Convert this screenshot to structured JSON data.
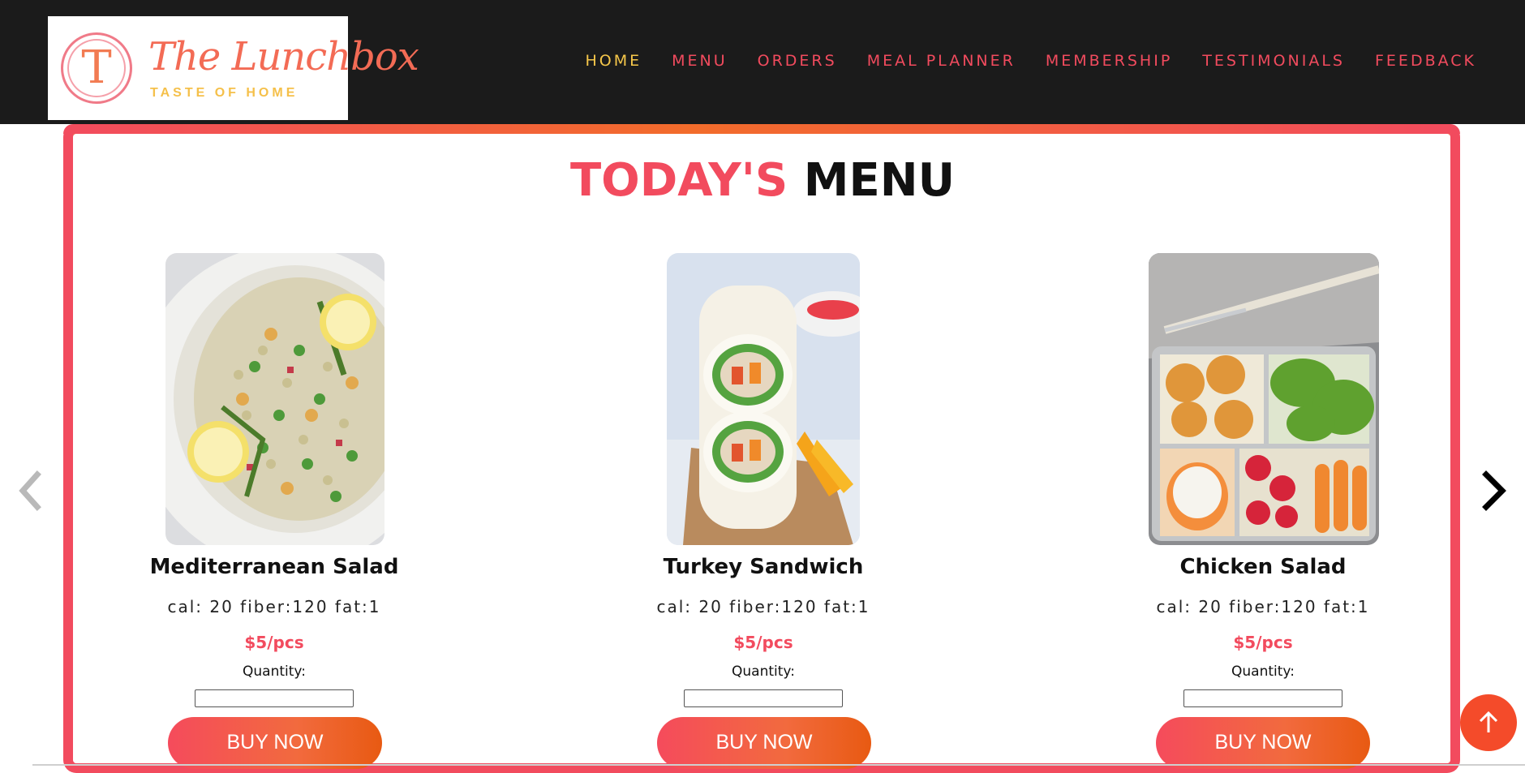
{
  "brand": {
    "logo_letter": "T",
    "logo_name": "The Lunchbox",
    "logo_tagline": "TASTE OF HOME"
  },
  "nav": {
    "items": [
      {
        "label": "HOME",
        "active": true
      },
      {
        "label": "MENU",
        "active": false
      },
      {
        "label": "ORDERS",
        "active": false
      },
      {
        "label": "MEAL PLANNER",
        "active": false
      },
      {
        "label": "MEMBERSHIP",
        "active": false
      },
      {
        "label": "TESTIMONIALS",
        "active": false
      },
      {
        "label": "FEEDBACK",
        "active": false
      }
    ]
  },
  "menu": {
    "title_highlight": "TODAY'S",
    "title_rest": "MENU",
    "items": [
      {
        "name": "Mediterranean Salad",
        "stats": "cal: 20 fiber:120 fat:1",
        "price": "$5/pcs",
        "quantity_label": "Quantity:",
        "quantity_value": "",
        "buy_label": "BUY NOW",
        "image": "pasta-salad-image"
      },
      {
        "name": "Turkey Sandwich",
        "stats": "cal: 20 fiber:120 fat:1",
        "price": "$5/pcs",
        "quantity_label": "Quantity:",
        "quantity_value": "",
        "buy_label": "BUY NOW",
        "image": "turkey-wrap-image"
      },
      {
        "name": "Chicken Salad",
        "stats": "cal: 20 fiber:120 fat:1",
        "price": "$5/pcs",
        "quantity_label": "Quantity:",
        "quantity_value": "",
        "buy_label": "BUY NOW",
        "image": "chicken-lunchbox-image"
      }
    ]
  },
  "colors": {
    "accent": "#f24b5e",
    "nav_active": "#f6c74a",
    "header_bg": "#1b1b1b",
    "button_gradient_end": "#e85a12"
  },
  "icons": {
    "prev": "chevron-left-icon",
    "next": "chevron-right-icon",
    "scroll_top": "arrow-up-icon"
  }
}
